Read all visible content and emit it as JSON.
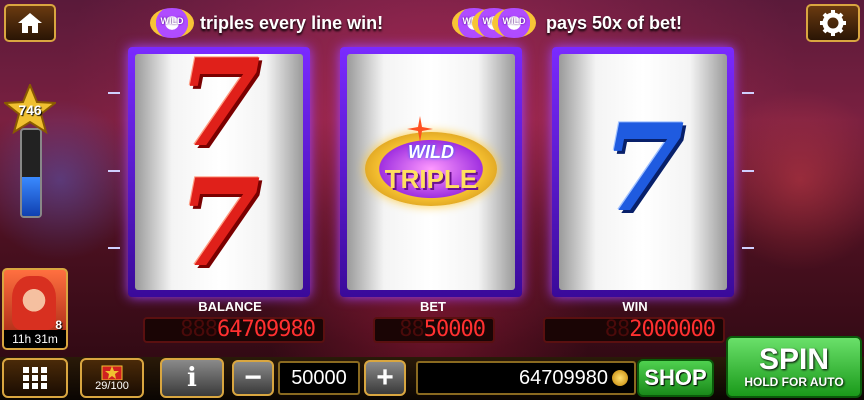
{
  "level": "746",
  "topbar": {
    "banner_left_text": "triples every line win!",
    "banner_right_text": "pays 50x of bet!",
    "badge_text": "WILD"
  },
  "reels": {
    "reel1_symbol": "7",
    "reel2_top": "WILD",
    "reel2_bottom": "TRIPLE",
    "reel3_symbol": "7"
  },
  "panels": {
    "balance_label": "BALANCE",
    "bet_label": "BET",
    "win_label": "WIN",
    "balance_ghost": "888",
    "balance_value": "64709980",
    "bet_ghost": "88",
    "bet_value": "50000",
    "win_ghost": "88",
    "win_value": "2000000"
  },
  "player": {
    "count": "8",
    "timer": "11h 31m"
  },
  "bottom": {
    "gift_count": "29/100",
    "bet_amount": "50000",
    "coin_balance": "64709980",
    "shop_label": "SHOP",
    "spin_label": "SPIN",
    "spin_sub": "HOLD FOR AUTO",
    "info_label": "i",
    "minus_label": "−",
    "plus_label": "+"
  },
  "colors": {
    "reel_frame": "#7a2aff",
    "counter_text": "#ff3030",
    "spin_green": "#2fb82f",
    "gold_border": "#d9a640"
  }
}
